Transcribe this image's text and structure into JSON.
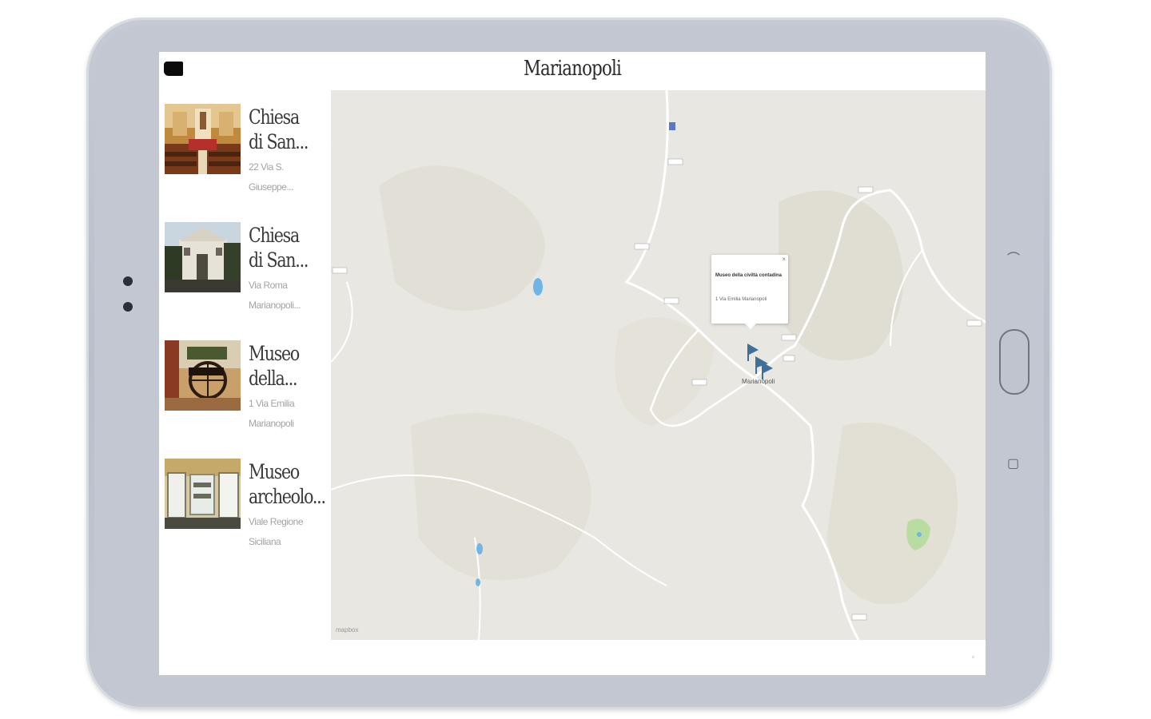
{
  "app": {
    "title": "Marianopoli"
  },
  "places": [
    {
      "name": "Chiesa di San...",
      "address": "22 Via S. Giuseppe..."
    },
    {
      "name": "Chiesa di San...",
      "address": "Via Roma Marianopoli..."
    },
    {
      "name": "Museo della...",
      "address": "1 Via Emilia Marianopoli"
    },
    {
      "name": "Museo archeolo...",
      "address": "Viale Regione Siciliana"
    }
  ],
  "map": {
    "popup": {
      "title": "Museo della civiltà contadina",
      "address": "1 Via Emilia Marianopoli",
      "close": "×"
    },
    "town_label": "Marianopoli",
    "attribution": "mapbox"
  },
  "colors": {
    "marker": "#3f6f9b",
    "water": "#6fb5e6",
    "map_bg": "#e9e6df",
    "frame": "#c2c7d1"
  }
}
